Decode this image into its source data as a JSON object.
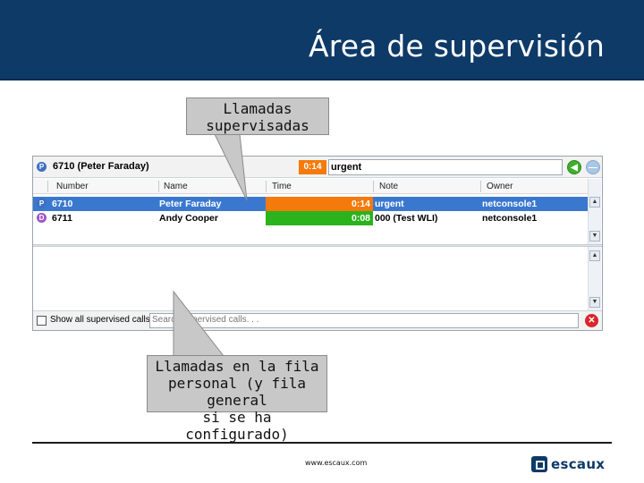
{
  "header": {
    "title": "Área de supervisión"
  },
  "callouts": {
    "top": {
      "line1": "Llamadas",
      "line2": "supervisadas"
    },
    "bottom": {
      "line1": "Llamadas en la fila",
      "line2": "personal (y fila general",
      "line3": "si se ha configurado)"
    }
  },
  "panel": {
    "topbar": {
      "title": "6710 (Peter Faraday)",
      "timer": "0:14",
      "note_value": "urgent",
      "icon_p": "P"
    },
    "columns": [
      "Number",
      "Name",
      "Time",
      "Note",
      "Owner"
    ],
    "rows": [
      {
        "icon": "P",
        "number": "6710",
        "name": "Peter Faraday",
        "time": "0:14",
        "note": "urgent",
        "owner": "netconsole1",
        "time_color": "#f47a0c"
      },
      {
        "icon": "D",
        "number": "6711",
        "name": "Andy Cooper",
        "time": "0:08",
        "note": "000 (Test WLI)",
        "owner": "netconsole1",
        "time_color": "#2bb31d"
      }
    ],
    "footer": {
      "show_all_label": "Show all supervised calls",
      "search_placeholder": "Search supervised calls. . ."
    }
  },
  "footer": {
    "url": "www.escaux.com",
    "logo_text": "escaux"
  },
  "colors": {
    "header_bg": "#0e3a68",
    "selected_row": "#3a78d0",
    "timer_orange": "#f47a0c",
    "timer_green": "#2bb31d"
  }
}
